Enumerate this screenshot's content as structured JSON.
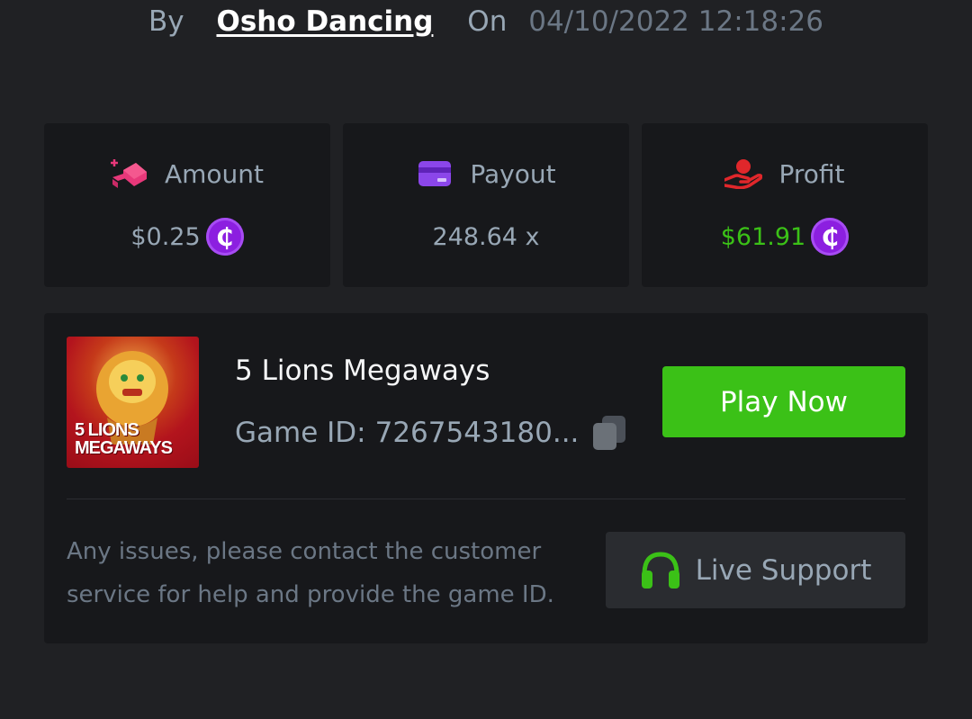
{
  "header": {
    "by_label": "By",
    "username": "Osho Dancing",
    "on_label": "On",
    "datetime": "04/10/2022 12:18:26"
  },
  "stats": {
    "amount": {
      "label": "Amount",
      "value": "$0.25",
      "icon": "bet-chips-icon",
      "icon_color": "#e8387a"
    },
    "payout": {
      "label": "Payout",
      "value": "248.64 x",
      "icon": "card-icon",
      "icon_color": "#8b46ea"
    },
    "profit": {
      "label": "Profit",
      "value": "$61.91",
      "icon": "hand-money-icon",
      "icon_color": "#e0272b",
      "value_color": "#3bc117"
    },
    "coin_symbol": "₵",
    "coin_color": "#8c1fe0"
  },
  "game": {
    "name": "5 Lions Megaways",
    "thumbnail_text": [
      "5 LIONS",
      "MEGAWAYS"
    ],
    "id_label": "Game ID:",
    "id_value": "7267543180...",
    "play_label": "Play Now",
    "play_color": "#3bc117"
  },
  "support": {
    "message": "Any issues, please contact the customer service for help and provide the game ID.",
    "button_label": "Live Support",
    "icon": "headset-icon"
  }
}
